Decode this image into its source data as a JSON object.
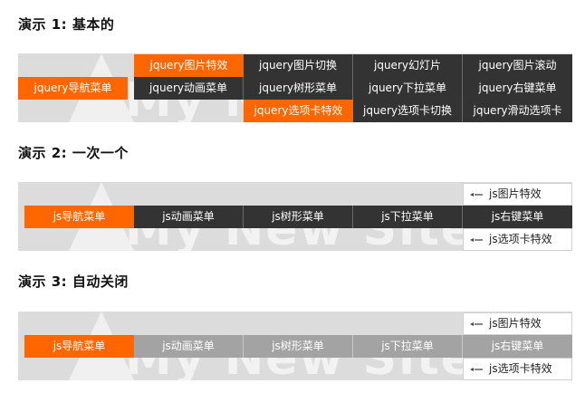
{
  "demo1": {
    "title": "演示 1: 基本的",
    "main": "jquery导航菜单",
    "col2": [
      "jquery图片特效",
      "jquery动画菜单"
    ],
    "col3": [
      "jquery图片切换",
      "jquery树形菜单",
      "jquery选项卡特效"
    ],
    "col4": [
      "jquery幻灯片",
      "jquery下拉菜单",
      "jquery选项卡切换"
    ],
    "col5": [
      "jquery图片滚动",
      "jquery右键菜单",
      "jquery滑动选项卡"
    ]
  },
  "demo2": {
    "title": "演示 2: 一次一个",
    "nav": [
      "js导航菜单",
      "js动画菜单",
      "js树形菜单",
      "js下拉菜单",
      "js右键菜单"
    ],
    "popup": [
      "js图片特效",
      "js选项卡特效"
    ]
  },
  "demo3": {
    "title": "演示 3: 自动关闭",
    "nav": [
      "js导航菜单",
      "js动画菜单",
      "js树形菜单",
      "js下拉菜单",
      "js右键菜单"
    ],
    "popup": [
      "js图片特效",
      "js选项卡特效"
    ]
  },
  "watermark": "My New Site",
  "colors": {
    "orange": "#ff6600",
    "dark": "#333333",
    "gray": "#a3a3a3",
    "stage": "#dcdcdc"
  }
}
